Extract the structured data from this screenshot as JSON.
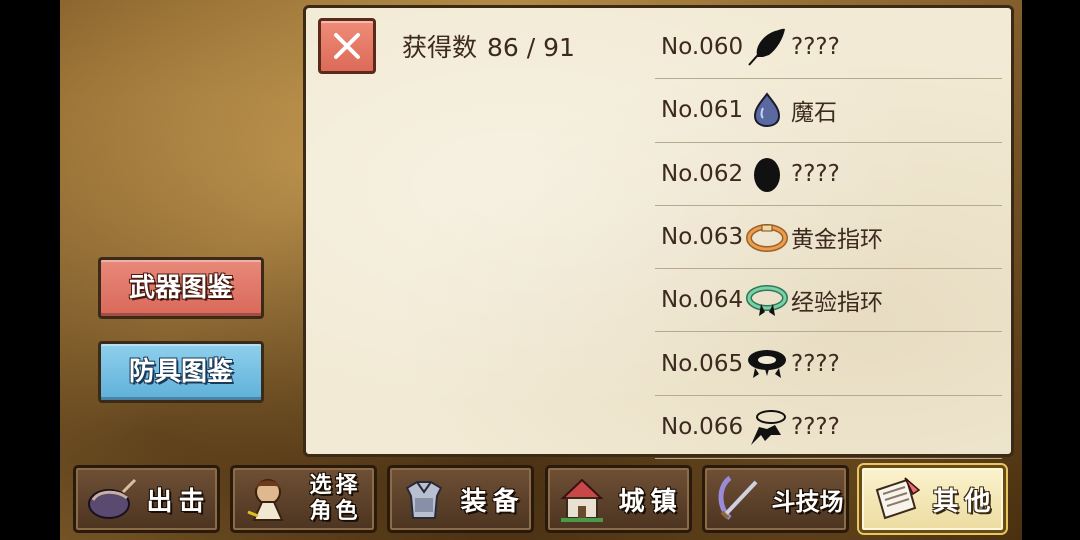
{
  "side_tabs": {
    "weapon": "武器图鉴",
    "armor": "防具图鉴"
  },
  "panel": {
    "close_icon": "close-x-icon",
    "count_label": "获得数",
    "count_value": "86 / 91"
  },
  "items": [
    {
      "no": "No.060",
      "name": "????",
      "icon": "feather-silhouette-icon"
    },
    {
      "no": "No.061",
      "name": "魔石",
      "icon": "magic-stone-icon"
    },
    {
      "no": "No.062",
      "name": "????",
      "icon": "egg-silhouette-icon"
    },
    {
      "no": "No.063",
      "name": "黄金指环",
      "icon": "gold-ring-icon"
    },
    {
      "no": "No.064",
      "name": "经验指环",
      "icon": "experience-ring-icon"
    },
    {
      "no": "No.065",
      "name": "????",
      "icon": "ring-silhouette-icon"
    },
    {
      "no": "No.066",
      "name": "????",
      "icon": "scarf-silhouette-icon"
    }
  ],
  "nav": [
    {
      "label": "出击",
      "icon": "sortie-icon"
    },
    {
      "label": "选择角色",
      "line1": "选择",
      "line2": "角色",
      "icon": "character-select-icon"
    },
    {
      "label": "装备",
      "icon": "armor-equip-icon"
    },
    {
      "label": "城镇",
      "icon": "town-icon"
    },
    {
      "label": "斗技场",
      "icon": "arena-icon"
    },
    {
      "label": "其他",
      "icon": "other-scroll-icon",
      "active": true
    }
  ]
}
